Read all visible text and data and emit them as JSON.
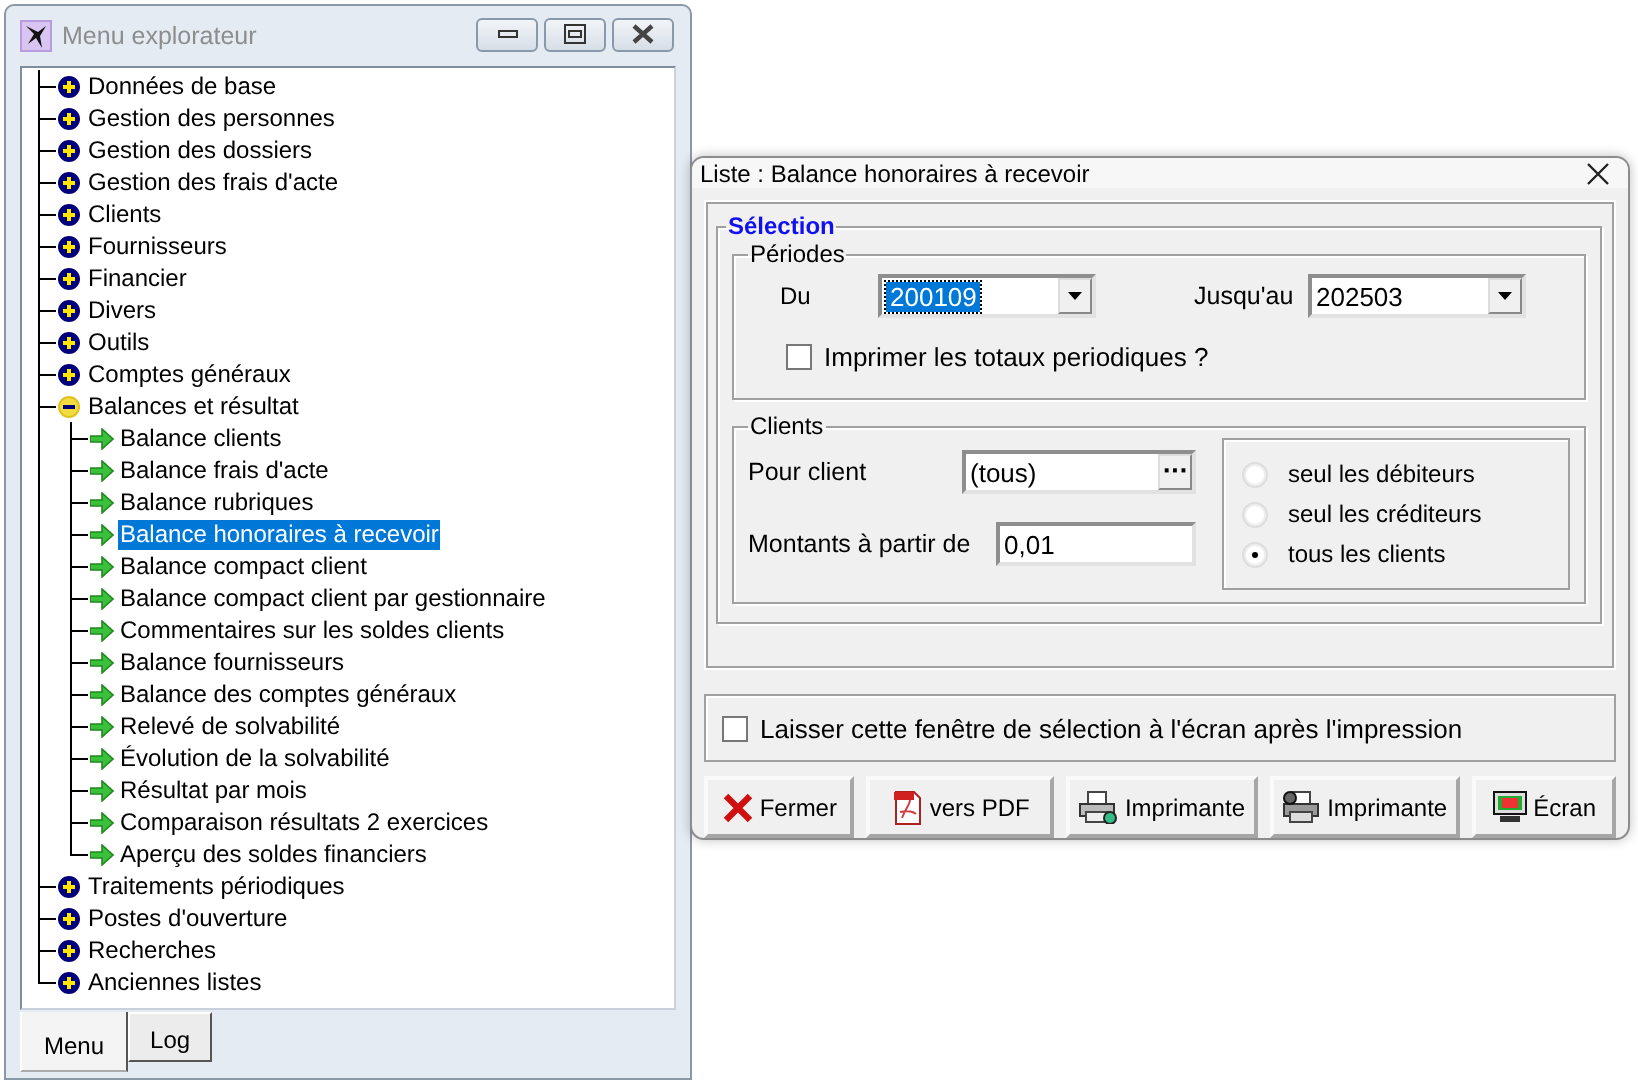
{
  "explorer": {
    "title": "Menu explorateur",
    "tree": [
      {
        "label": "Données de base",
        "expanded": false,
        "selected": false
      },
      {
        "label": "Gestion des personnes",
        "expanded": false,
        "selected": false
      },
      {
        "label": "Gestion des dossiers",
        "expanded": false,
        "selected": false
      },
      {
        "label": "Gestion des frais d'acte",
        "expanded": false,
        "selected": false
      },
      {
        "label": "Clients",
        "expanded": false,
        "selected": false
      },
      {
        "label": "Fournisseurs",
        "expanded": false,
        "selected": false
      },
      {
        "label": "Financier",
        "expanded": false,
        "selected": false
      },
      {
        "label": "Divers",
        "expanded": false,
        "selected": false
      },
      {
        "label": "Outils",
        "expanded": false,
        "selected": false
      },
      {
        "label": "Comptes généraux",
        "expanded": false,
        "selected": false
      },
      {
        "label": "Balances et résultat",
        "expanded": true,
        "selected": false,
        "children": [
          {
            "label": "Balance clients",
            "selected": false
          },
          {
            "label": "Balance frais d'acte",
            "selected": false
          },
          {
            "label": "Balance rubriques",
            "selected": false
          },
          {
            "label": "Balance honoraires à recevoir",
            "selected": true
          },
          {
            "label": "Balance compact client",
            "selected": false
          },
          {
            "label": "Balance compact client par gestionnaire",
            "selected": false
          },
          {
            "label": "Commentaires sur les soldes clients",
            "selected": false
          },
          {
            "label": "Balance fournisseurs",
            "selected": false
          },
          {
            "label": "Balance des comptes généraux",
            "selected": false
          },
          {
            "label": "Relevé de solvabilité",
            "selected": false
          },
          {
            "label": "Évolution de la solvabilité",
            "selected": false
          },
          {
            "label": "Résultat par mois",
            "selected": false
          },
          {
            "label": "Comparaison résultats 2 exercices",
            "selected": false
          },
          {
            "label": "Aperçu des soldes financiers",
            "selected": false
          }
        ]
      },
      {
        "label": "Traitements périodiques",
        "expanded": false,
        "selected": false
      },
      {
        "label": "Postes d'ouverture",
        "expanded": false,
        "selected": false
      },
      {
        "label": "Recherches",
        "expanded": false,
        "selected": false
      },
      {
        "label": "Anciennes listes",
        "expanded": false,
        "selected": false
      }
    ],
    "tabs": [
      {
        "label": "Menu",
        "selected": true
      },
      {
        "label": "Log",
        "selected": false
      }
    ]
  },
  "dialog": {
    "title": "Liste : Balance honoraires à recevoir",
    "selection_title": "Sélection",
    "periods": {
      "title": "Périodes",
      "from_label": "Du",
      "from_value": "200109",
      "from_highlighted": true,
      "to_label": "Jusqu'au",
      "to_value": "202503",
      "to_highlighted": false,
      "totals_checkbox": {
        "label": "Imprimer les totaux periodiques ?",
        "checked": false
      }
    },
    "clients": {
      "title": "Clients",
      "client_label": "Pour client",
      "client_value": "(tous)",
      "browse_label": "···",
      "amount_label": "Montants à partir de",
      "amount_value": "0,01",
      "radios": [
        {
          "label": "seul les débiteurs",
          "selected": false
        },
        {
          "label": "seul les créditeurs",
          "selected": false
        },
        {
          "label": "tous les clients",
          "selected": true
        }
      ]
    },
    "keep_open": {
      "label": "Laisser cette fenêtre de sélection à l'écran après l'impression",
      "checked": false
    },
    "buttons": [
      {
        "label": "Fermer",
        "kind": "close"
      },
      {
        "label": "vers PDF",
        "kind": "pdf"
      },
      {
        "label": "Imprimante",
        "kind": "printer"
      },
      {
        "label": "Imprimante",
        "kind": "printer-setup"
      },
      {
        "label": "Écran",
        "kind": "screen"
      }
    ]
  }
}
